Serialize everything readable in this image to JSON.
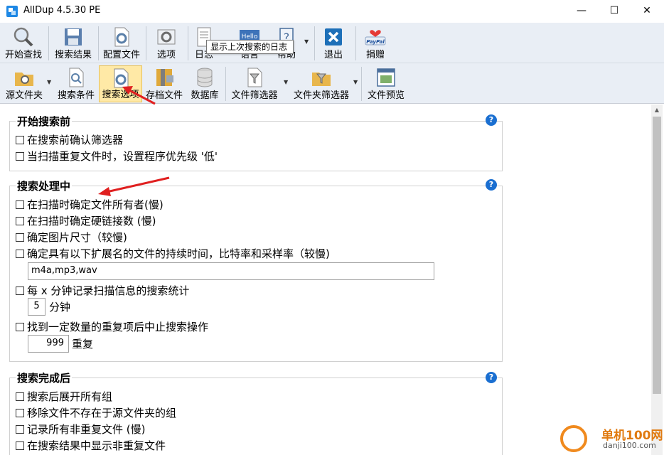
{
  "window": {
    "title": "AllDup 4.5.30 PE",
    "minimize": "—",
    "maximize": "☐",
    "close": "✕"
  },
  "toolbar1": {
    "items": [
      {
        "label": "开始查找",
        "icon": "magnifier-icon"
      },
      {
        "label": "搜索结果",
        "icon": "save-results-icon"
      },
      {
        "label": "配置文件",
        "icon": "config-file-icon"
      },
      {
        "label": "选项",
        "icon": "options-icon"
      },
      {
        "label": "日志",
        "icon": "log-icon"
      },
      {
        "label": "语言",
        "icon": "language-icon",
        "icon_text": "Hello"
      },
      {
        "label": "帮助",
        "icon": "help-icon"
      },
      {
        "label": "退出",
        "icon": "exit-icon"
      },
      {
        "label": "捐赠",
        "icon": "paypal-icon",
        "icon_text": "PayPal"
      }
    ],
    "tooltip": "显示上次搜索的日志"
  },
  "toolbar2": {
    "items": [
      {
        "label": "源文件夹",
        "icon": "source-folder-icon"
      },
      {
        "label": "搜索条件",
        "icon": "search-criteria-icon"
      },
      {
        "label": "搜索选项",
        "icon": "search-options-icon",
        "active": true
      },
      {
        "label": "存档文件",
        "icon": "archive-icon"
      },
      {
        "label": "数据库",
        "icon": "database-icon"
      },
      {
        "label": "文件筛选器",
        "icon": "file-filter-icon"
      },
      {
        "label": "文件夹筛选器",
        "icon": "folder-filter-icon"
      },
      {
        "label": "文件预览",
        "icon": "file-preview-icon"
      }
    ]
  },
  "sections": {
    "before": {
      "title": "开始搜索前",
      "options": [
        "在搜索前确认筛选器",
        "当扫描重复文件时，设置程序优先级 '低'"
      ]
    },
    "during": {
      "title": "搜索处理中",
      "options": [
        "在扫描时确定文件所有者(慢)",
        "在扫描时确定硬链接数 (慢)",
        "确定图片尺寸（较慢)",
        "确定具有以下扩展名的文件的持续时间，比特率和采样率（较慢)",
        "每 x 分钟记录扫描信息的搜索统计",
        "找到一定数量的重复项后中止搜索操作"
      ],
      "extensions_value": "m4a,mp3,wav",
      "minutes_value": "5",
      "minutes_unit": "分钟",
      "duplicates_value": "999",
      "duplicates_unit": "重复"
    },
    "after": {
      "title": "搜索完成后",
      "options": [
        "搜索后展开所有组",
        "移除文件不存在于源文件夹的组",
        "记录所有非重复文件 (慢)",
        "在搜索结果中显示非重复文件"
      ]
    }
  },
  "watermark": {
    "name": "单机100网",
    "url": "danji100.com"
  },
  "colors": {
    "toolbar_bg": "#e9eef5",
    "active_button": "#ffe9a6",
    "help_blue": "#1a6fd1",
    "annotation_red": "#e02020"
  }
}
